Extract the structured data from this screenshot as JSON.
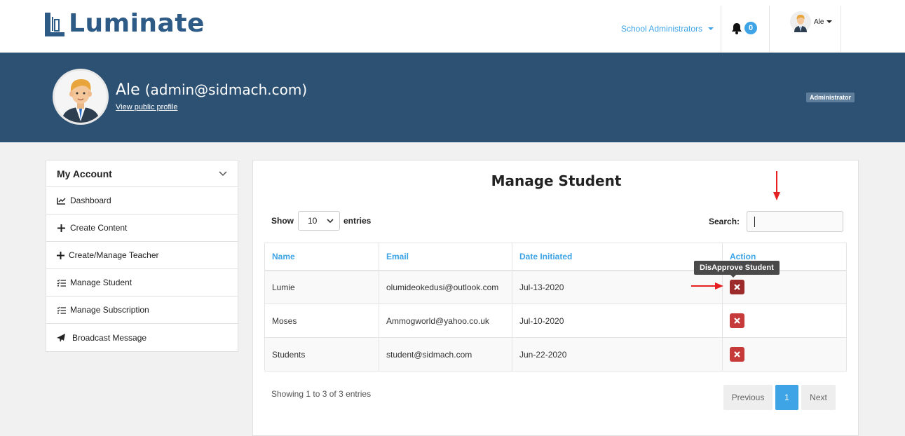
{
  "brand": {
    "name": "Luminate",
    "color": "#2e5a86"
  },
  "topnav": {
    "admin_menu_label": "School Administrators",
    "notification_count": "0",
    "user_label": "Ale"
  },
  "profile": {
    "name": "Ale",
    "email": "(admin@sidmach.com)",
    "public_link": "View public profile",
    "role": "Administrator"
  },
  "sidebar": {
    "title": "My Account",
    "items": [
      {
        "label": "Dashboard",
        "icon": "chart-line-icon"
      },
      {
        "label": "Create Content",
        "icon": "plus-icon"
      },
      {
        "label": "Create/Manage Teacher",
        "icon": "plus-icon"
      },
      {
        "label": "Manage Student",
        "icon": "tasks-icon"
      },
      {
        "label": "Manage Subscription",
        "icon": "tasks-icon"
      },
      {
        "label": "Broadcast Message",
        "icon": "paper-plane-icon"
      }
    ]
  },
  "main": {
    "title": "Manage Student",
    "show_label": "Show",
    "entries_value": "10",
    "entries_label": "entries",
    "search_label": "Search:",
    "search_value": "",
    "columns": [
      "Name",
      "Email",
      "Date Initiated",
      "Action"
    ],
    "rows": [
      {
        "name": "Lumie",
        "email": "olumideokedusi@outlook.com",
        "date": "Jul-13-2020"
      },
      {
        "name": "Moses",
        "email": "Ammogworld@yahoo.co.uk",
        "date": "Jul-10-2020"
      },
      {
        "name": "Students",
        "email": "student@sidmach.com",
        "date": "Jun-22-2020"
      }
    ],
    "tooltip": "DisApprove Student",
    "info": "Showing 1 to 3 of 3 entries",
    "pagination": {
      "previous": "Previous",
      "current": "1",
      "next": "Next"
    }
  },
  "colors": {
    "banner": "#2d5173",
    "accent": "#3ea4e6",
    "danger": "#c63a3a",
    "annotation_arrow": "#e62020"
  }
}
